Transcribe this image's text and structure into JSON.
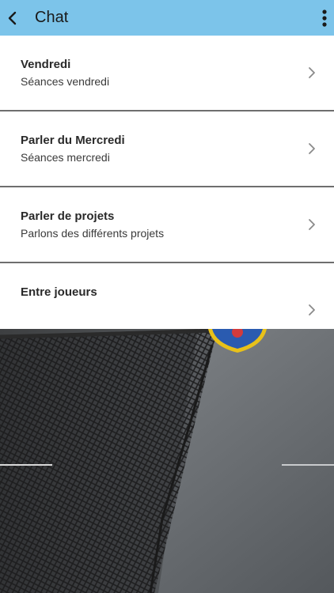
{
  "header": {
    "title": "Chat",
    "back_icon": "chevron-left-icon",
    "menu_icon": "more-vertical-icon",
    "background_color": "#7cc4ea"
  },
  "chat_rooms": [
    {
      "title": "Vendredi",
      "subtitle": "Séances vendredi"
    },
    {
      "title": "Parler du Mercredi",
      "subtitle": "Séances mercredi"
    },
    {
      "title": "Parler de projets",
      "subtitle": "Parlons des différents projets"
    },
    {
      "title": "Entre joueurs",
      "subtitle": ""
    }
  ]
}
